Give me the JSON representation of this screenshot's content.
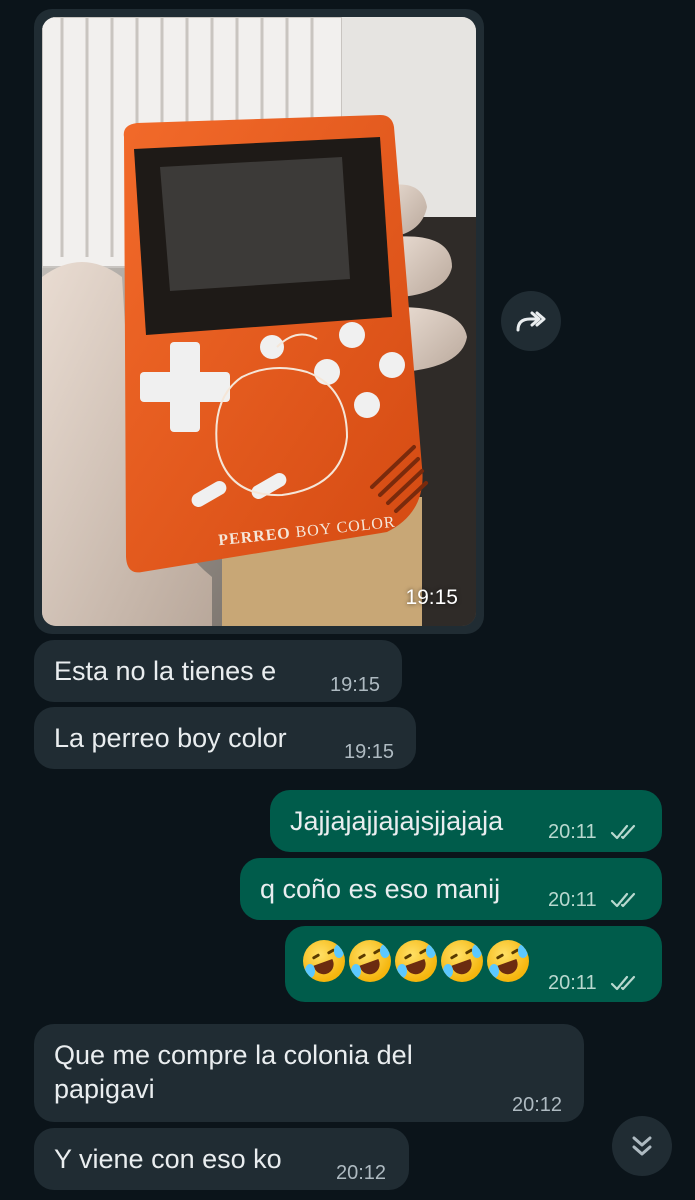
{
  "photo": {
    "time": "19:15",
    "device_brand": "PERREO",
    "device_label": "BOY COLOR"
  },
  "messages": [
    {
      "text": "Esta no la tienes e",
      "time": "19:15"
    },
    {
      "text": "La perreo boy color",
      "time": "19:15"
    },
    {
      "text": "Jajjajajjajajsjjajaja",
      "time": "20:11"
    },
    {
      "text": "q coño es eso manij",
      "time": "20:11"
    },
    {
      "text": "",
      "time": "20:11"
    },
    {
      "text_line1": "Que me compre la colonia del",
      "text_line2": "papigavi",
      "time": "20:12"
    },
    {
      "text": "Y viene con eso ko",
      "time": "20:12"
    }
  ],
  "icons": {
    "forward": "forward-icon",
    "scroll_down": "double-chevron-down-icon",
    "read_receipt": "double-check-icon",
    "emoji": "rolling-on-floor-laughing-emoji"
  },
  "colors": {
    "background": "#0b141a",
    "incoming_bubble": "#202c33",
    "outgoing_bubble": "#005c4b",
    "device": "#e8581c"
  }
}
